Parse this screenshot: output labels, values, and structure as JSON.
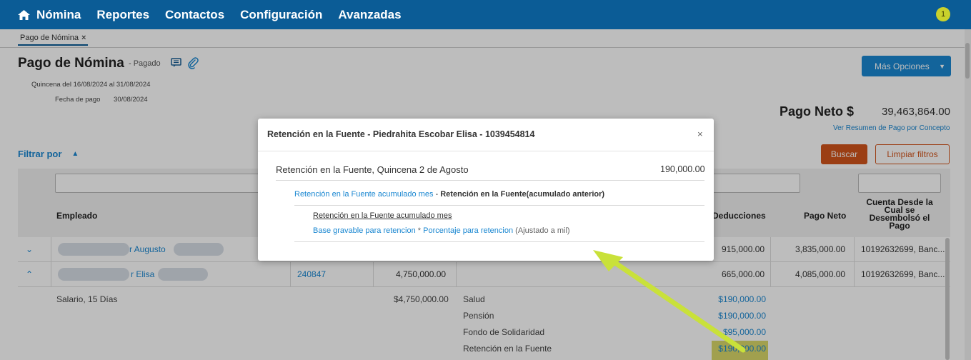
{
  "nav": {
    "items": [
      "Nómina",
      "Reportes",
      "Contactos",
      "Configuración",
      "Avanzadas"
    ],
    "notification_count": "1"
  },
  "tab": {
    "label": "Pago de Nómina",
    "close": "×"
  },
  "header": {
    "title": "Pago de Nómina",
    "status": "- Pagado",
    "period": "Quincena del 16/08/2024 al 31/08/2024",
    "payment_date_label": "Fecha de pago",
    "payment_date": "30/08/2024",
    "more_options": "Más Opciones"
  },
  "summary": {
    "net_label": "Pago Neto $",
    "net_value": "39,463,864.00",
    "concept_link": "Ver Resumen de Pago por Concepto"
  },
  "filters": {
    "label": "Filtrar por",
    "search_button": "Buscar",
    "clear_button": "Limpiar filtros"
  },
  "table": {
    "headers": {
      "employee": "Empleado",
      "deductions": "Deducciones",
      "net_pay": "Pago Neto",
      "account": "Cuenta Desde la Cual se Desembolsó el Pago"
    },
    "rows": [
      {
        "name": "r Augusto",
        "deductions": "915,000.00",
        "net": "3,835,000.00",
        "account": "10192632699, Banc..."
      },
      {
        "name": "r Elisa",
        "code": "240847",
        "salary": "4,750,000.00",
        "deductions": "665,000.00",
        "net": "4,085,000.00",
        "account": "10192632699, Banc..."
      }
    ],
    "detail": {
      "salary_label": "Salario, 15 Días",
      "salary_value": "$4,750,000.00",
      "items": [
        {
          "label": "Salud",
          "value": "$190,000.00"
        },
        {
          "label": "Pensión",
          "value": "$190,000.00"
        },
        {
          "label": "Fondo de Solidaridad",
          "value": "$95,000.00"
        },
        {
          "label": "Retención en la Fuente",
          "value": "$190,000.00"
        }
      ]
    }
  },
  "modal": {
    "title": "Retención en la Fuente - Piedrahita Escobar Elisa - 1039454814",
    "close": "×",
    "line_label": "Retención en la Fuente, Quincena 2 de Agosto",
    "line_value": "190,000.00",
    "formula_link": "Retención en la Fuente acumulado mes",
    "formula_sep": " - ",
    "formula_bold": "Retención en la Fuente(acumulado anterior)",
    "sub_title": "Retención en la Fuente acumulado mes",
    "sub_link1": "Base gravable para retencion",
    "sub_op": " * ",
    "sub_link2": "Porcentaje para retencion",
    "sub_note": " (Ajustado a mil)"
  },
  "colors": {
    "nav_bg": "#0b5c96",
    "accent": "#1a87d1",
    "buscar": "#d2541c",
    "annotation": "#c9e13a"
  }
}
